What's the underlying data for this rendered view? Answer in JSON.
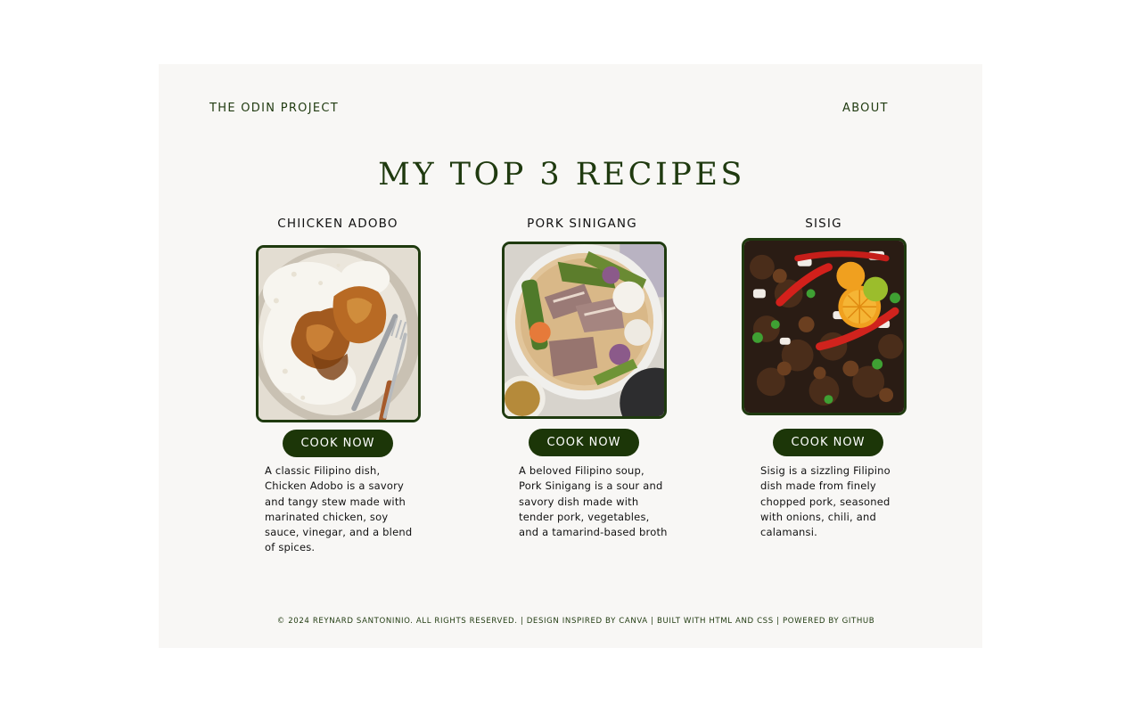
{
  "nav": {
    "brand": "THE ODIN PROJECT",
    "about": "ABOUT"
  },
  "page_title": "MY TOP 3 RECIPES",
  "recipes": [
    {
      "title": "CHIICKEN ADOBO",
      "button": "COOK NOW",
      "description": "A classic Filipino dish, Chicken Adobo is a savory and tangy stew made with marinated chicken, soy sauce, vinegar, and a blend of spices.",
      "image_icon": "chicken-adobo-photo"
    },
    {
      "title": "PORK SINIGANG",
      "button": "COOK NOW",
      "description": "A beloved Filipino soup, Pork Sinigang is a sour and savory dish made with tender pork, vegetables, and a tamarind-based broth",
      "image_icon": "pork-sinigang-photo"
    },
    {
      "title": "SISIG",
      "button": "COOK NOW",
      "description": "Sisig is a sizzling Filipino dish made from finely chopped pork, seasoned with onions, chili, and calamansi.",
      "image_icon": "sisig-photo"
    }
  ],
  "footer": {
    "copyright": "© 2024 REYNARD SANTONINIO. ALL RIGHTS RESERVED.",
    "design": "DESIGN INSPIRED BY CANVA",
    "built": "BUILT WITH HTML AND CSS",
    "powered": "POWERED BY GITHUB",
    "separator": "|"
  },
  "colors": {
    "accent": "#1c3608",
    "panel": "#f8f7f5",
    "text": "#111111"
  }
}
